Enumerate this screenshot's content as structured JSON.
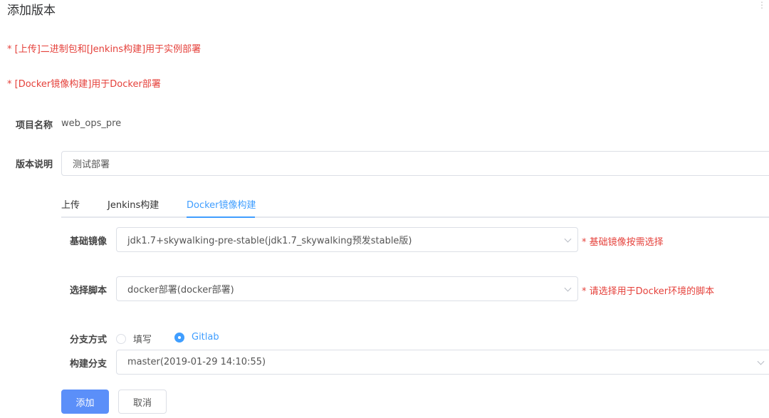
{
  "dialog": {
    "title": "添加版本"
  },
  "notes": [
    "* [上传]二进制包和[Jenkins构建]用于实例部署",
    "* [Docker镜像构建]用于Docker部署"
  ],
  "form": {
    "project_name_label": "项目名称",
    "project_name_value": "web_ops_pre",
    "version_desc_label": "版本说明",
    "version_desc_value": "测试部署"
  },
  "tabs": [
    {
      "label": "上传",
      "active": false
    },
    {
      "label": "Jenkins构建",
      "active": false
    },
    {
      "label": "Docker镜像构建",
      "active": true
    }
  ],
  "docker": {
    "base_image_label": "基础镜像",
    "base_image_value": "jdk1.7+skywalking-pre-stable(jdk1.7_skywalking预发stable版)",
    "base_image_hint": "* 基础镜像按需选择",
    "script_label": "选择脚本",
    "script_value": "docker部署(docker部署)",
    "script_hint": "* 请选择用于Docker环境的脚本",
    "branch_mode_label": "分支方式",
    "branch_mode_options": [
      "填写",
      "Gitlab"
    ],
    "branch_mode_selected": "Gitlab",
    "build_branch_label": "构建分支",
    "build_branch_value": "master(2019-01-29 14:10:55)"
  },
  "buttons": {
    "add": "添加",
    "cancel": "取消"
  },
  "colors": {
    "primary": "#409eff",
    "button": "#5b8ff9",
    "warning_text": "#e5413b"
  }
}
